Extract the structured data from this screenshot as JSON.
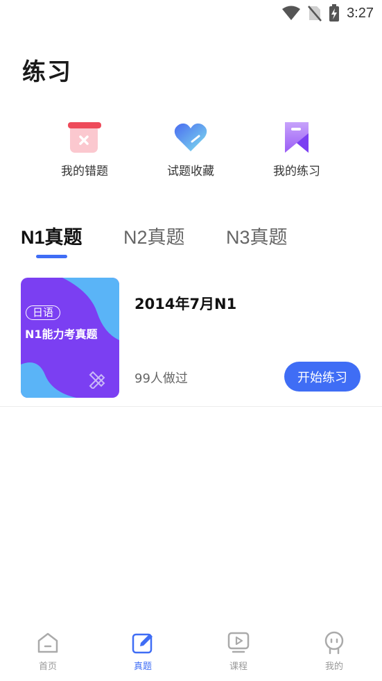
{
  "status_bar": {
    "time": "3:27",
    "icons": [
      "wifi-icon",
      "no-sim-icon",
      "battery-charging-icon"
    ]
  },
  "page": {
    "title": "练习"
  },
  "quick_actions": [
    {
      "label": "我的错题",
      "icon": "wrong-questions-icon"
    },
    {
      "label": "试题收藏",
      "icon": "favorites-heart-icon"
    },
    {
      "label": "我的练习",
      "icon": "bookmark-icon"
    }
  ],
  "tabs": [
    {
      "label": "N1真题",
      "active": true
    },
    {
      "label": "N2真题",
      "active": false
    },
    {
      "label": "N3真题",
      "active": false
    }
  ],
  "exam_list": [
    {
      "cover_tag": "日语",
      "cover_title": "N1能力考真题",
      "title": "2014年7月N1",
      "count": "99人做过",
      "button": "开始练习"
    }
  ],
  "bottom_nav": [
    {
      "label": "首页",
      "icon": "home-icon",
      "active": false
    },
    {
      "label": "真题",
      "icon": "edit-icon",
      "active": true
    },
    {
      "label": "课程",
      "icon": "video-course-icon",
      "active": false
    },
    {
      "label": "我的",
      "icon": "profile-icon",
      "active": false
    }
  ],
  "colors": {
    "accent": "#3f6df5",
    "cover_purple": "#7b3ff2",
    "cover_blue": "#5ab4f7",
    "wrong_red": "#ee4a5a"
  }
}
